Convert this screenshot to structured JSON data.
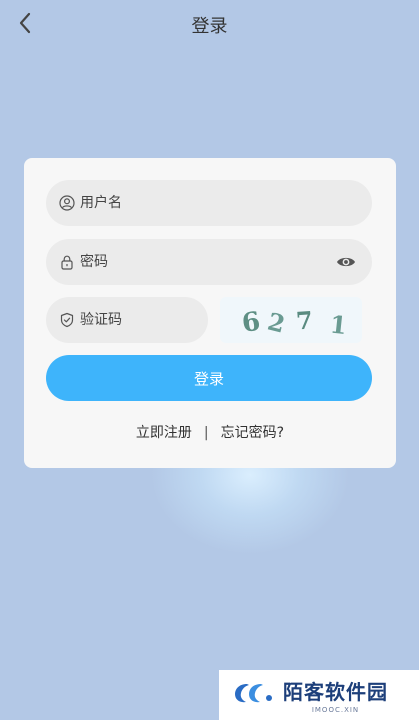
{
  "header": {
    "title": "登录"
  },
  "form": {
    "username_placeholder": "用户名",
    "password_placeholder": "密码",
    "captcha_placeholder": "验证码",
    "captcha_digits": [
      "6",
      "2",
      "7",
      "1"
    ],
    "login_label": "登录"
  },
  "links": {
    "register": "立即注册",
    "separator": "|",
    "forgot": "忘记密码?"
  },
  "watermark": {
    "name": "陌客软件园",
    "sub": "IMOOC.XIN"
  },
  "colors": {
    "background": "#b3c8e6",
    "accent": "#3eb4fb",
    "card": "#f7f7f7",
    "field": "#ebebeb",
    "captcha_text": "#5e8f84"
  },
  "icons": {
    "back": "chevron-left-icon",
    "user": "user-circle-icon",
    "lock": "lock-icon",
    "eye": "eye-icon",
    "shield": "shield-icon"
  }
}
